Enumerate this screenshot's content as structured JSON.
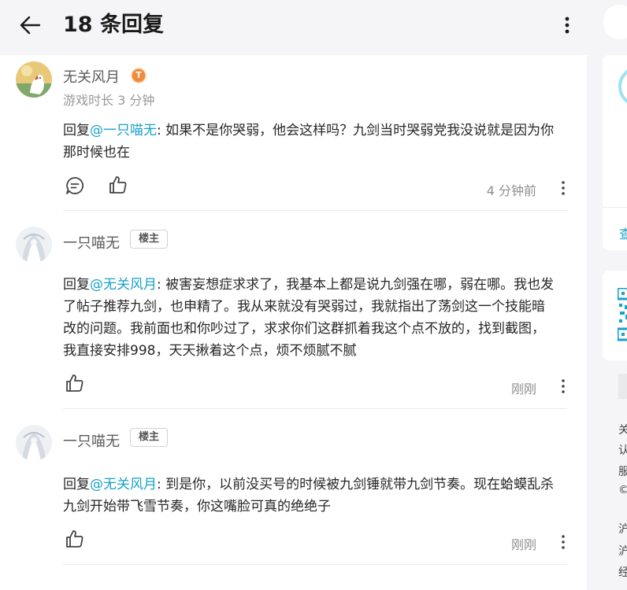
{
  "header": {
    "title": "18 条回复"
  },
  "comments": [
    {
      "author": "无关风月",
      "level_badge": "T",
      "subtitle": "游戏时长 3 分钟",
      "reply_prefix": "回复",
      "mention": "@一只喵无",
      "text_line1": ": 如果不是你哭弱，他会这样吗？九剑当时哭弱党我没说就是因为你",
      "text_line2": "那时候也在",
      "time": "4 分钟前"
    },
    {
      "author": "一只喵无",
      "badge": "楼主",
      "reply_prefix": "回复",
      "mention": "@无关风月",
      "text_line1": ": 被害妄想症求求了，我基本上都是说九剑强在哪，弱在哪。我也发",
      "text_line2": "了帖子推荐九剑，也申精了。我从来就没有哭弱过，我就指出了荡剑这一个技能暗",
      "text_line3": "改的问题。我前面也和你吵过了，求求你们这群抓着我这个点不放的，找到截图，",
      "text_line4": "我直接安排998，天天揪着这个点，烦不烦腻不腻",
      "time": "刚刚"
    },
    {
      "author": "一只喵无",
      "badge": "楼主",
      "reply_prefix": "回复",
      "mention": "@无关风月",
      "text_line1": ": 到是你，以前没买号的时候被九剑锤就带九剑节奏。现在蛤蟆乱杀",
      "text_line2": "九剑开始带飞雪节奏，你这嘴脸可真的绝绝子",
      "time": "刚刚"
    }
  ],
  "sidebar": {
    "card1_link": "查",
    "footer_lines": [
      "关",
      "认",
      "服",
      "©",
      "沪",
      "沪",
      "经"
    ]
  },
  "colors": {
    "mention": "#17a2c9",
    "page_bg": "#f5f5f7",
    "panel_bg": "#ffffff",
    "level_badge": "#f08a3c"
  },
  "icons": [
    "back-arrow-icon",
    "more-vertical-icon",
    "comment-icon",
    "thumbs-up-icon",
    "dots-vertical-icon",
    "qr-code-icon"
  ]
}
